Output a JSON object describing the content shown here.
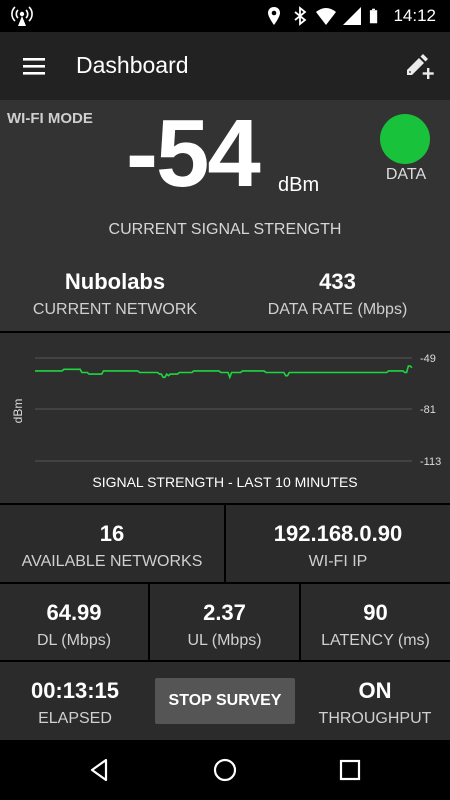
{
  "status_bar": {
    "time": "14:12",
    "icons": [
      "broadcast-icon",
      "location-icon",
      "bluetooth-icon",
      "wifi-icon",
      "cell-signal-icon",
      "battery-icon"
    ]
  },
  "app_bar": {
    "title": "Dashboard",
    "menu_icon": "menu-icon",
    "action_icon": "edit-add-icon"
  },
  "hero": {
    "mode": "WI-FI MODE",
    "signal_value": "-54",
    "signal_unit": "dBm",
    "data_indicator_label": "DATA",
    "data_indicator_color": "#18c23a",
    "caption": "CURRENT SIGNAL STRENGTH"
  },
  "network": {
    "name": "Nubolabs",
    "name_label": "CURRENT NETWORK",
    "data_rate": "433",
    "data_rate_label": "DATA RATE (Mbps)"
  },
  "chart_data": {
    "type": "line",
    "title": "SIGNAL STRENGTH - LAST 10 MINUTES",
    "ylabel": "dBm",
    "xlabel": "",
    "ylim": [
      -113,
      -49
    ],
    "yticks": [
      "-49",
      "-81",
      "-113"
    ],
    "grid": true,
    "line_color": "#1ed640",
    "series": [
      {
        "values": [
          -57,
          -57,
          -57,
          -57,
          -57,
          -57,
          -57,
          -57,
          -57,
          -57,
          -57,
          -57,
          -57,
          -57,
          -57,
          -57,
          -56,
          -56,
          -56,
          -56,
          -56,
          -56,
          -56,
          -56,
          -56,
          -56,
          -58,
          -58,
          -58,
          -58,
          -59,
          -59,
          -59,
          -59,
          -59,
          -59,
          -59,
          -59,
          -57,
          -57,
          -57,
          -57,
          -57,
          -57,
          -57,
          -57,
          -57,
          -57,
          -57,
          -57,
          -57,
          -57,
          -57,
          -57,
          -57,
          -57,
          -57,
          -57,
          -58,
          -58,
          -58,
          -58,
          -58,
          -58,
          -58,
          -58,
          -58,
          -58,
          -58,
          -59,
          -59,
          -61,
          -61,
          -59,
          -60,
          -59,
          -59,
          -59,
          -59,
          -59,
          -58,
          -58,
          -58,
          -58,
          -58,
          -58,
          -58,
          -58,
          -57,
          -57,
          -57,
          -57,
          -57,
          -57,
          -57,
          -57,
          -57,
          -57,
          -57,
          -57,
          -57,
          -57,
          -57,
          -58,
          -58,
          -58,
          -58,
          -58,
          -61,
          -58,
          -58,
          -58,
          -58,
          -58,
          -58,
          -57,
          -57,
          -57,
          -57,
          -57,
          -57,
          -57,
          -57,
          -57,
          -57,
          -57,
          -57,
          -57,
          -58,
          -58,
          -58,
          -58,
          -58,
          -58,
          -58,
          -58,
          -58,
          -58,
          -58,
          -60,
          -60,
          -58,
          -58,
          -58,
          -58,
          -58,
          -58,
          -58,
          -58,
          -58,
          -58,
          -58,
          -58,
          -58,
          -58,
          -58,
          -58,
          -58,
          -58,
          -58,
          -58,
          -58,
          -58,
          -58,
          -58,
          -58,
          -58,
          -58,
          -58,
          -58,
          -58,
          -58,
          -58,
          -58,
          -58,
          -58,
          -58,
          -58,
          -58,
          -58,
          -58,
          -58,
          -58,
          -58,
          -58,
          -58,
          -58,
          -58,
          -58,
          -58,
          -58,
          -58,
          -58,
          -58,
          -58,
          -58,
          -57,
          -57,
          -57,
          -57,
          -57,
          -57,
          -57,
          -57,
          -57,
          -58,
          -58,
          -54,
          -54,
          -55
        ]
      }
    ]
  },
  "stats_row1": {
    "available_networks": "16",
    "available_networks_label": "AVAILABLE NETWORKS",
    "wifi_ip": "192.168.0.90",
    "wifi_ip_label": "WI-FI IP"
  },
  "stats_row2": {
    "dl": "64.99",
    "dl_label": "DL (Mbps)",
    "ul": "2.37",
    "ul_label": "UL (Mbps)",
    "latency": "90",
    "latency_label": "LATENCY (ms)"
  },
  "controls": {
    "elapsed": "00:13:15",
    "elapsed_label": "ELAPSED",
    "stop_button": "STOP SURVEY",
    "throughput": "ON",
    "throughput_label": "THROUGHPUT"
  },
  "nav_bar": {
    "icons": [
      "back-icon",
      "home-icon",
      "recents-icon"
    ]
  }
}
